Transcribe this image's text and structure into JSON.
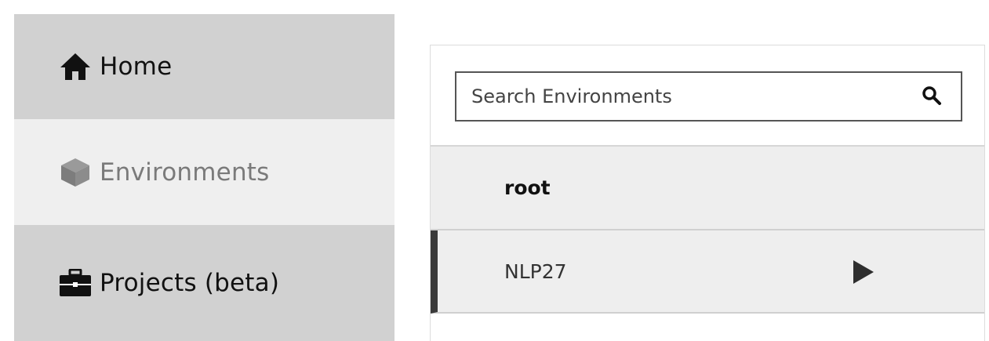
{
  "sidebar": {
    "items": [
      {
        "label": "Home",
        "icon": "home-icon"
      },
      {
        "label": "Environments",
        "icon": "cube-icon"
      },
      {
        "label": "Projects (beta)",
        "icon": "briefcase-icon"
      }
    ]
  },
  "environments": {
    "search": {
      "placeholder": "Search Environments",
      "icon": "search-icon"
    },
    "items": [
      {
        "label": "root"
      },
      {
        "label": "NLP27",
        "action_icon": "play-arrow-icon"
      }
    ]
  },
  "colors": {
    "sidebar_bg": "#d1d1d1",
    "sidebar_active_bg": "#efefef",
    "row_bg": "#eeeeee",
    "active_indicator": "#3a3a3a"
  }
}
